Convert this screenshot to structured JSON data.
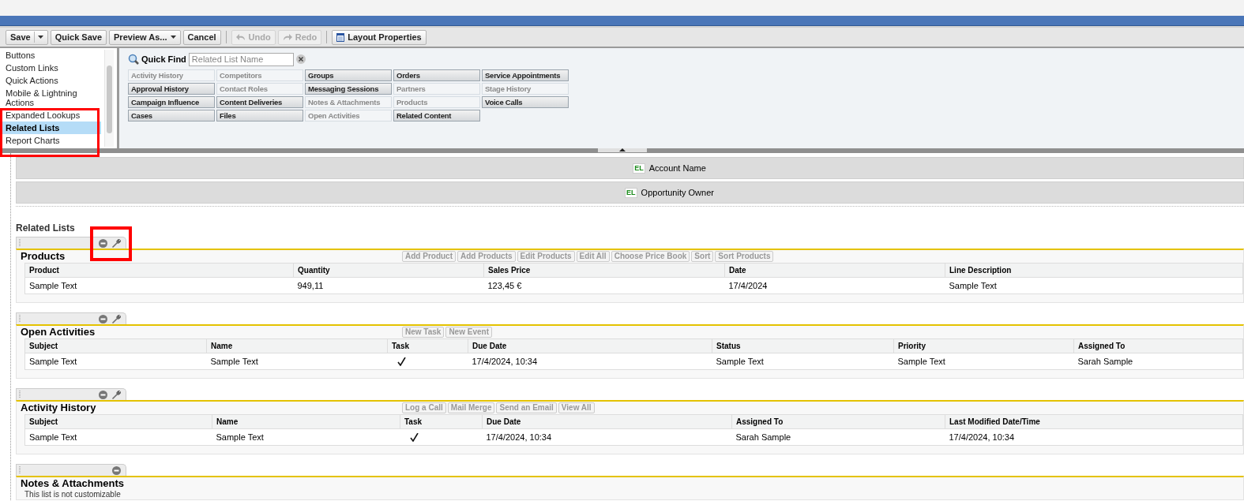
{
  "toolbar": [
    {
      "kind": "split",
      "label": "Save",
      "disabled": false
    },
    {
      "kind": "plain",
      "label": "Quick Save",
      "disabled": false
    },
    {
      "kind": "menu",
      "label": "Preview As...",
      "disabled": false
    },
    {
      "kind": "plain",
      "label": "Cancel",
      "disabled": false
    },
    {
      "kind": "separator"
    },
    {
      "kind": "undo",
      "label": "Undo",
      "disabled": true
    },
    {
      "kind": "redo",
      "label": "Redo",
      "disabled": true
    },
    {
      "kind": "separator"
    },
    {
      "kind": "layout",
      "label": "Layout Properties",
      "disabled": false
    }
  ],
  "sidebar": {
    "items": [
      {
        "label": "Buttons",
        "selected": false
      },
      {
        "label": "Custom Links",
        "selected": false
      },
      {
        "label": "Quick Actions",
        "selected": false
      },
      {
        "label": "Mobile & Lightning Actions",
        "selected": false
      },
      {
        "label": "Expanded Lookups",
        "selected": false
      },
      {
        "label": "Related Lists",
        "selected": true
      },
      {
        "label": "Report Charts",
        "selected": false
      }
    ]
  },
  "quick_find": {
    "label": "Quick Find",
    "placeholder": "Related List Name"
  },
  "palette": [
    {
      "label": "Activity History",
      "disabled": true
    },
    {
      "label": "Approval History",
      "disabled": false
    },
    {
      "label": "Campaign Influence",
      "disabled": false
    },
    {
      "label": "Cases",
      "disabled": false
    },
    {
      "label": "Competitors",
      "disabled": true
    },
    {
      "label": "Contact Roles",
      "disabled": true
    },
    {
      "label": "Content Deliveries",
      "disabled": false
    },
    {
      "label": "Files",
      "disabled": false
    },
    {
      "label": "Groups",
      "disabled": false
    },
    {
      "label": "Messaging Sessions",
      "disabled": false
    },
    {
      "label": "Notes & Attachments",
      "disabled": true
    },
    {
      "label": "Open Activities",
      "disabled": true
    },
    {
      "label": "Orders",
      "disabled": false
    },
    {
      "label": "Partners",
      "disabled": true
    },
    {
      "label": "Products",
      "disabled": true
    },
    {
      "label": "Related Content",
      "disabled": false
    },
    {
      "label": "Service Appointments",
      "disabled": false
    },
    {
      "label": "Stage History",
      "disabled": true
    },
    {
      "label": "Voice Calls",
      "disabled": false
    }
  ],
  "fields": [
    {
      "badge": "EL",
      "label": "Account Name"
    },
    {
      "badge": "EL",
      "label": "Opportunity Owner"
    }
  ],
  "related_lists_heading": "Related Lists",
  "sections": [
    {
      "title": "Products",
      "removable": true,
      "configurable": true,
      "buttons": [
        "Add Product",
        "Add Products",
        "Edit Products",
        "Edit All",
        "Choose Price Book",
        "Sort",
        "Sort Products"
      ],
      "columns": [
        "Product",
        "Quantity",
        "Sales Price",
        "Date",
        "Line Description"
      ],
      "rows": [
        [
          "Sample Text",
          "949,11",
          "123,45 €",
          "17/4/2024",
          "Sample Text"
        ]
      ]
    },
    {
      "title": "Open Activities",
      "removable": true,
      "configurable": true,
      "buttons": [
        "New Task",
        "New Event"
      ],
      "columns": [
        "Subject",
        "Name",
        "Task",
        "Due Date",
        "Status",
        "Priority",
        "Assigned To"
      ],
      "rows": [
        [
          "Sample Text",
          "Sample Text",
          {
            "kind": "check",
            "checked": true
          },
          "17/4/2024, 10:34",
          "Sample Text",
          "Sample Text",
          "Sarah Sample"
        ]
      ]
    },
    {
      "title": "Activity History",
      "removable": true,
      "configurable": true,
      "buttons": [
        "Log a Call",
        "Mail Merge",
        "Send an Email",
        "View All"
      ],
      "columns": [
        "Subject",
        "Name",
        "Task",
        "Due Date",
        "Assigned To",
        "Last Modified Date/Time"
      ],
      "rows": [
        [
          "Sample Text",
          "Sample Text",
          {
            "kind": "check",
            "checked": true
          },
          "17/4/2024, 10:34",
          "Sarah Sample",
          "17/4/2024, 10:34"
        ]
      ]
    },
    {
      "title": "Notes & Attachments",
      "removable": true,
      "configurable": false,
      "note": "This list is not customizable"
    }
  ]
}
